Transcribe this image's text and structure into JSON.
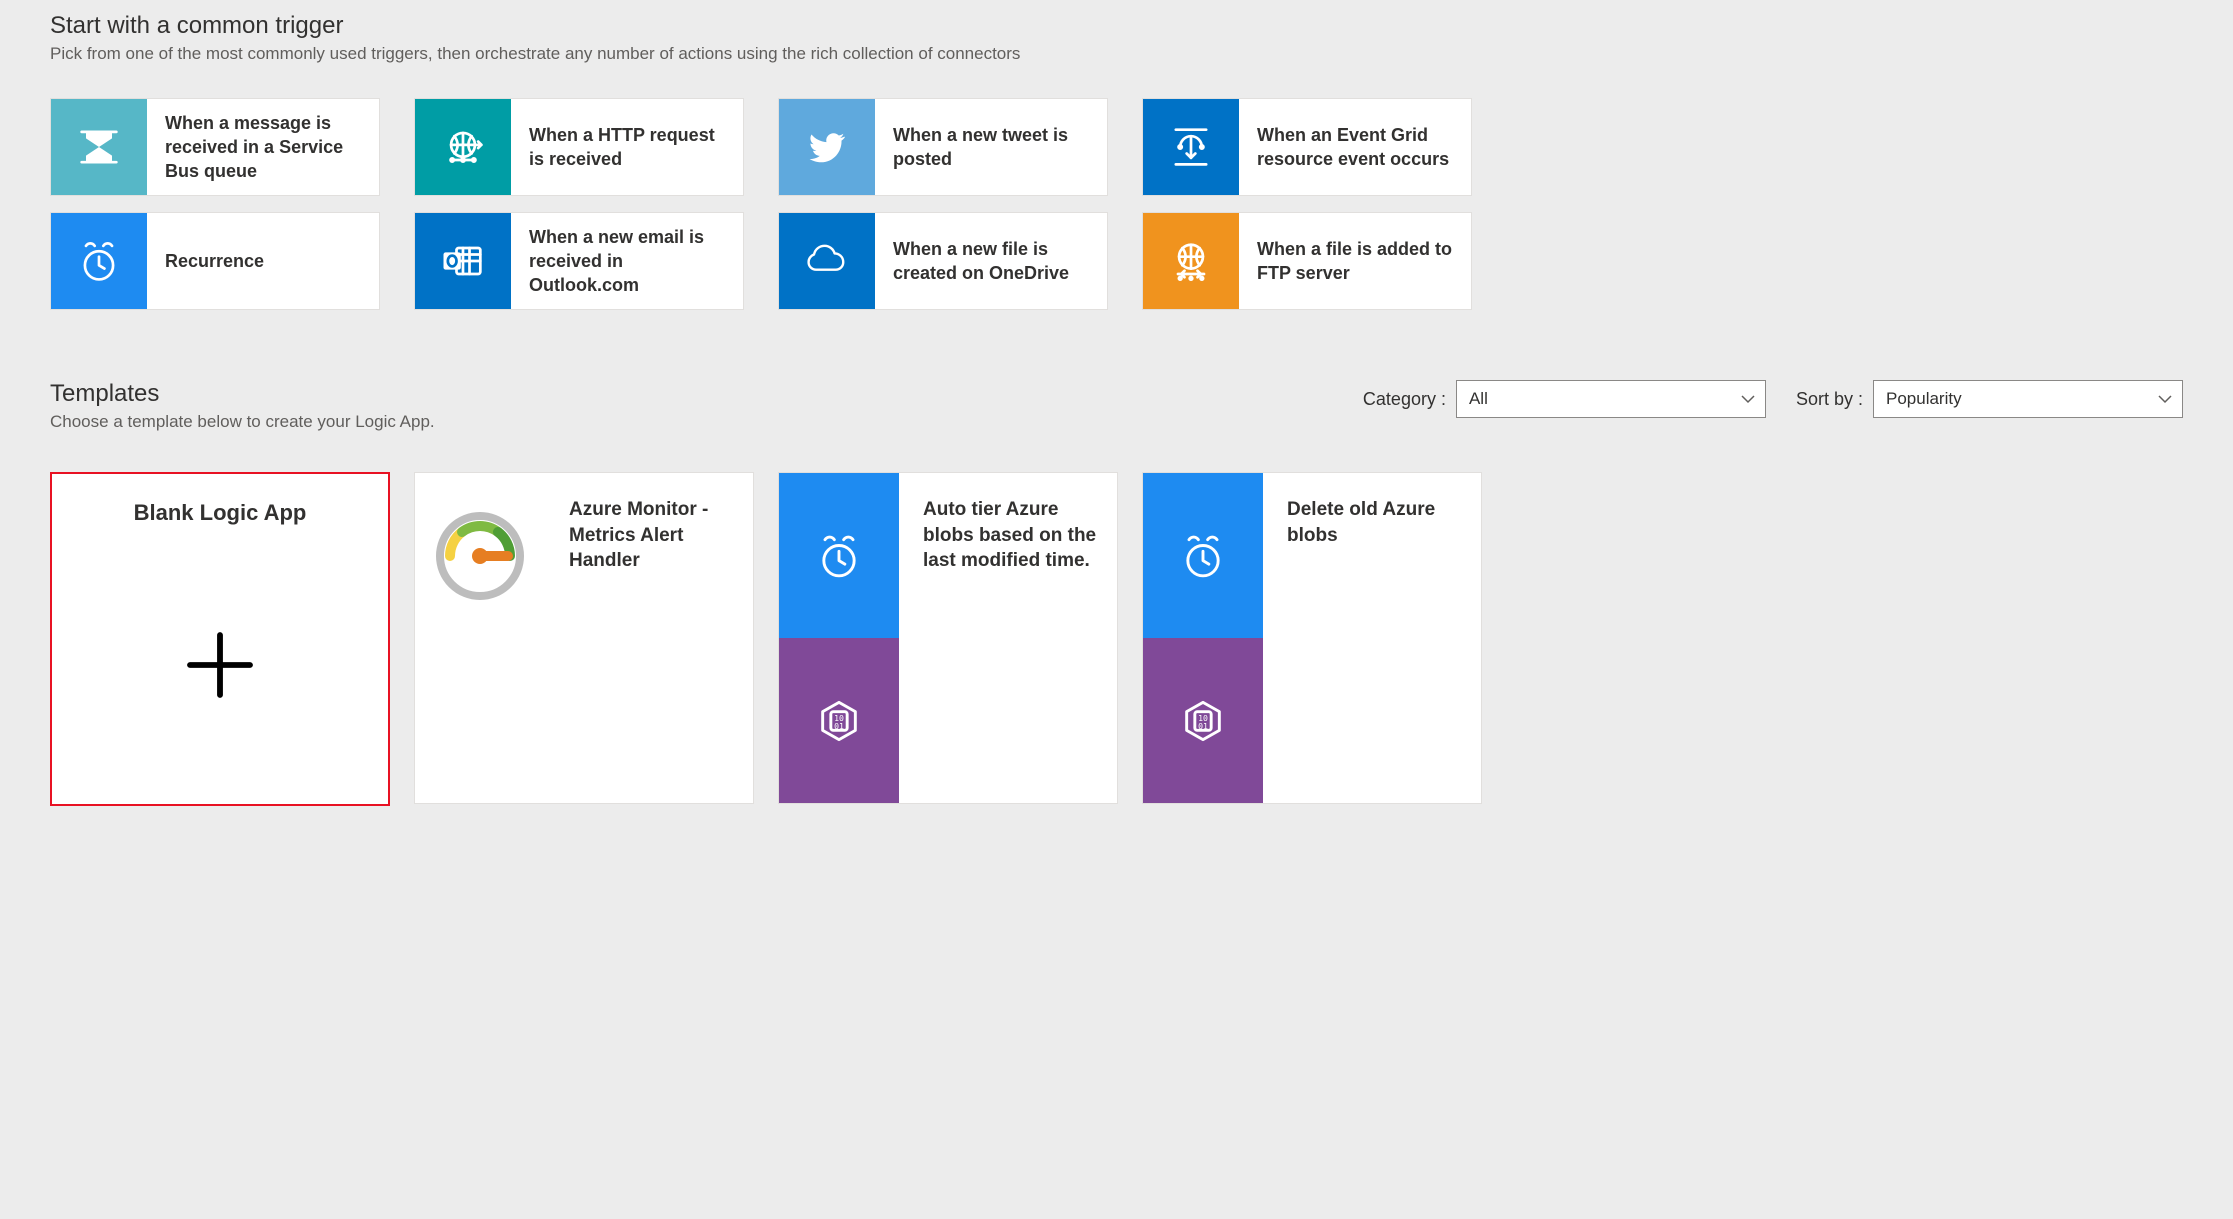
{
  "triggersSection": {
    "title": "Start with a common trigger",
    "subtitle": "Pick from one of the most commonly used triggers, then orchestrate any number of actions using the rich collection of connectors"
  },
  "triggers": [
    {
      "label": "When a message is received in a Service Bus queue",
      "icon": "service-bus",
      "color": "#56b7c7"
    },
    {
      "label": "When a HTTP request is received",
      "icon": "http",
      "color": "#009da5"
    },
    {
      "label": "When a new tweet is posted",
      "icon": "twitter",
      "color": "#5fa9dd"
    },
    {
      "label": "When an Event Grid resource event occurs",
      "icon": "event-grid",
      "color": "#0072c6"
    },
    {
      "label": "Recurrence",
      "icon": "clock",
      "color": "#1e8bf1"
    },
    {
      "label": "When a new email is received in Outlook.com",
      "icon": "outlook",
      "color": "#0072c6"
    },
    {
      "label": "When a new file is created on OneDrive",
      "icon": "onedrive",
      "color": "#0072c6"
    },
    {
      "label": "When a file is added to FTP server",
      "icon": "ftp",
      "color": "#f0931e"
    }
  ],
  "templatesSection": {
    "title": "Templates",
    "subtitle": "Choose a template below to create your Logic App."
  },
  "filters": {
    "categoryLabel": "Category :",
    "categoryValue": "All",
    "sortLabel": "Sort by :",
    "sortValue": "Popularity"
  },
  "templates": [
    {
      "kind": "blank",
      "title": "Blank Logic App"
    },
    {
      "kind": "single",
      "title": "Azure Monitor - Metrics Alert Handler",
      "icon": "gauge"
    },
    {
      "kind": "double",
      "title": "Auto tier Azure blobs based on the last modified time.",
      "icon1": "clock",
      "color1": "#1e8bf1",
      "icon2": "blob",
      "color2": "#804998"
    },
    {
      "kind": "double",
      "title": "Delete old Azure blobs",
      "icon1": "clock",
      "color1": "#1e8bf1",
      "icon2": "blob",
      "color2": "#804998"
    }
  ]
}
